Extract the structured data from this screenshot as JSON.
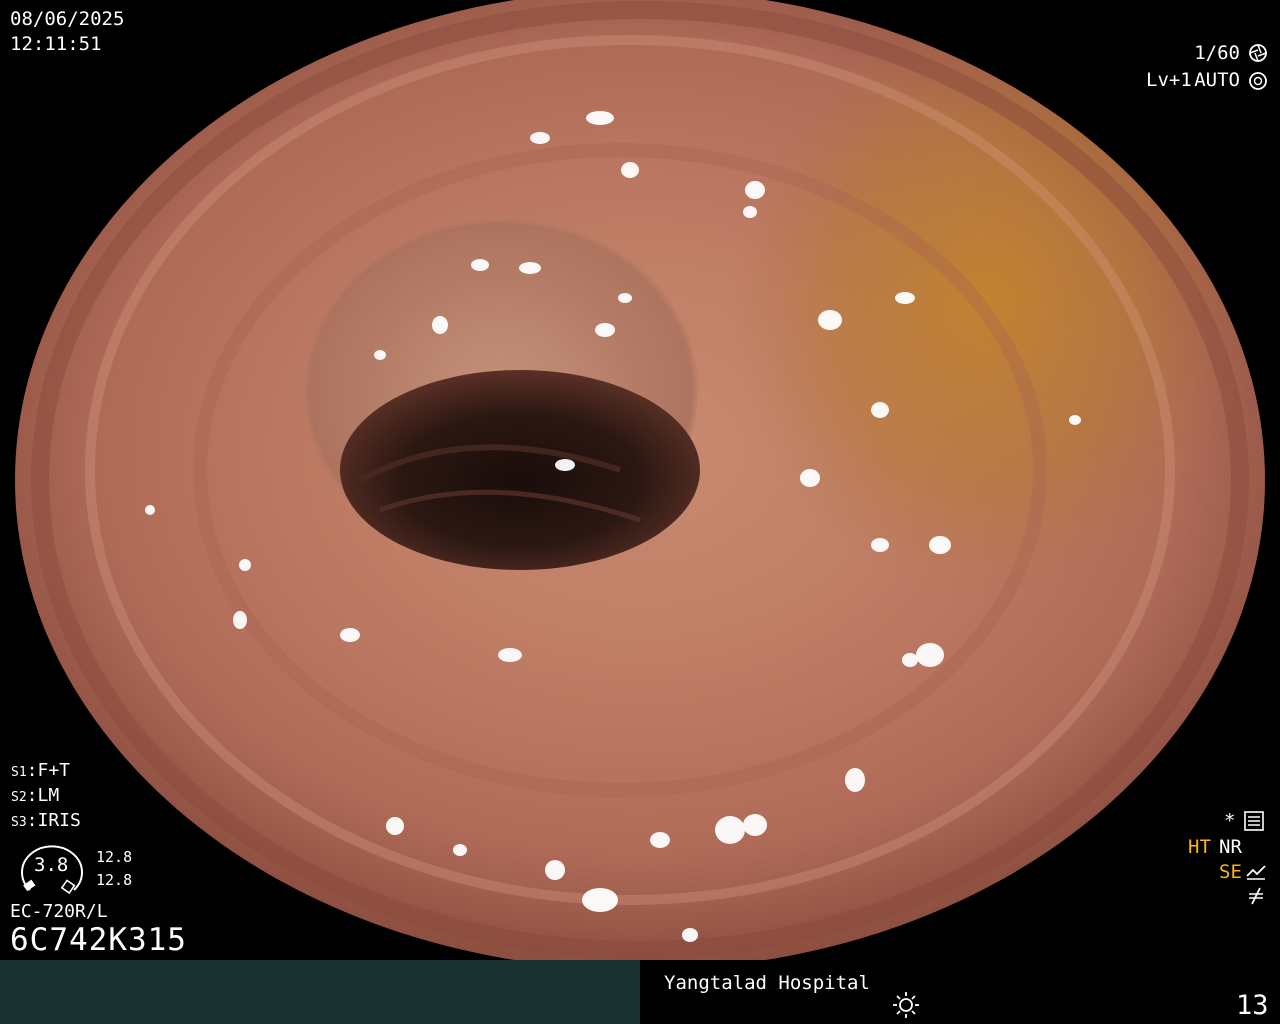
{
  "overlay": {
    "date": "08/06/2025",
    "time": "12:11:51",
    "shutter": "1/60",
    "level": "Lv+1",
    "iris_mode": "AUTO",
    "settings": [
      {
        "key": "S1",
        "value": "F+T"
      },
      {
        "key": "S2",
        "value": "LM"
      },
      {
        "key": "S3",
        "value": "IRIS"
      }
    ],
    "gauge_value": "3.8",
    "gauge_readout_1": "12.8",
    "gauge_readout_2": "12.8",
    "scope_model": "EC-720R/L",
    "serial": "6C742K315"
  },
  "right_status": {
    "ht": "HT",
    "nr": "NR",
    "se": "SE",
    "ht_color": "#ffb21c",
    "se_color": "#ffb21c"
  },
  "footer": {
    "hospital": "Yangtalad Hospital",
    "frame_count": "13",
    "left_panel_color": "#19302f"
  },
  "icons": [
    "shutter-icon",
    "iris-icon",
    "light-icon",
    "star-icon",
    "menu-grid-icon",
    "curve-icon",
    "lightning-icon",
    "sun-icon"
  ]
}
